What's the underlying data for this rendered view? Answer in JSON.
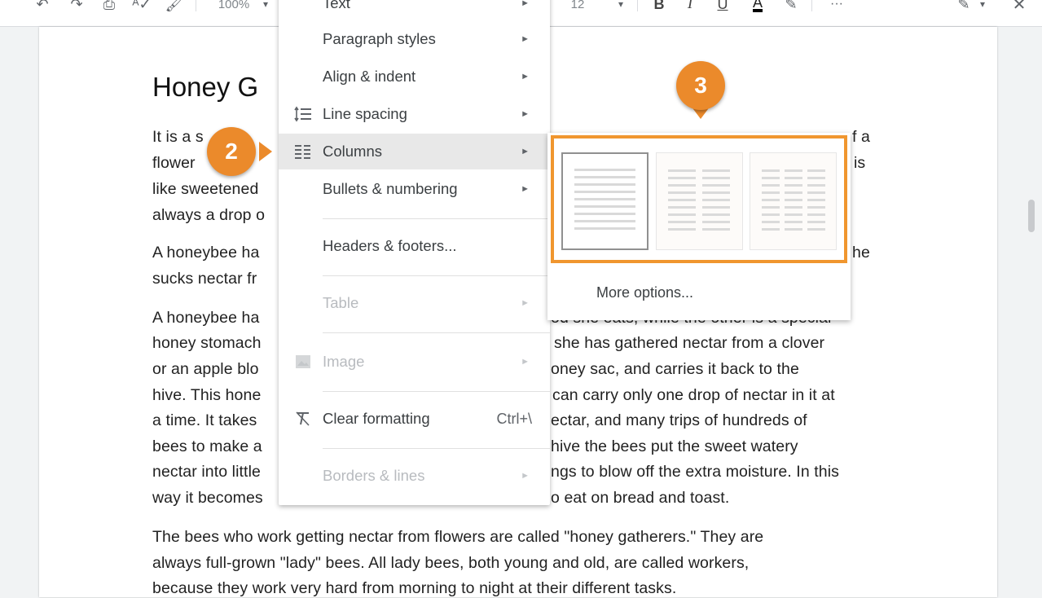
{
  "toolbar": {
    "zoom": "100%",
    "font_size": "12",
    "bold": "B",
    "italic": "I",
    "underline": "U",
    "text_color": "A",
    "more": "···"
  },
  "document": {
    "title": "Honey G",
    "lines": [
      "It is a s",
      "flower",
      "like sweetened",
      "always a drop o",
      "A honeybee ha",
      "sucks nectar fr",
      "A honeybee ha",
      "honey stomach",
      "or an apple blo",
      "hive. This hone",
      "a time. It takes",
      "bees to make a",
      "nectar into little",
      "way it becomes",
      "The bees who work getting nectar from flowers are called \"honey gatherers.\" They are",
      "always full-grown \"lady\" bees. All lady bees, both young and old, are called workers,",
      "because they work very hard from morning to night at their different tasks."
    ],
    "right_fragments": [
      "f a",
      "is",
      "he",
      "od she eats, while the other is a special",
      "she has gathered nectar from a clover",
      "oney sac, and carries it back to the",
      "can carry only one drop of nectar in it at",
      "ectar, and many trips of hundreds of",
      "hive the bees put the sweet watery",
      "ngs to blow off the extra moisture. In this",
      "o eat on bread and toast."
    ]
  },
  "format_menu": {
    "items": [
      {
        "label": "Text",
        "icon": "",
        "arrow": "►",
        "shortcut": "",
        "disabled": false
      },
      {
        "label": "Paragraph styles",
        "icon": "",
        "arrow": "►",
        "shortcut": "",
        "disabled": false
      },
      {
        "label": "Align & indent",
        "icon": "",
        "arrow": "►",
        "shortcut": "",
        "disabled": false
      },
      {
        "label": "Line spacing",
        "icon": "line-spacing-icon",
        "arrow": "►",
        "shortcut": "",
        "disabled": false
      },
      {
        "label": "Columns",
        "icon": "columns-icon",
        "arrow": "►",
        "shortcut": "",
        "disabled": false
      },
      {
        "label": "Bullets & numbering",
        "icon": "",
        "arrow": "►",
        "shortcut": "",
        "disabled": false
      },
      {
        "label": "Headers & footers...",
        "icon": "",
        "arrow": "",
        "shortcut": "",
        "disabled": false
      },
      {
        "label": "Table",
        "icon": "",
        "arrow": "►",
        "shortcut": "",
        "disabled": true
      },
      {
        "label": "Image",
        "icon": "image-icon",
        "arrow": "►",
        "shortcut": "",
        "disabled": true
      },
      {
        "label": "Clear formatting",
        "icon": "clear-formatting-icon",
        "arrow": "",
        "shortcut": "Ctrl+\\",
        "disabled": false
      },
      {
        "label": "Borders & lines",
        "icon": "",
        "arrow": "►",
        "shortcut": "",
        "disabled": true
      }
    ]
  },
  "columns_submenu": {
    "options": [
      "one-column",
      "two-columns",
      "three-columns"
    ],
    "selected": "one-column",
    "more_options": "More options..."
  },
  "callouts": {
    "step2": "2",
    "step3": "3",
    "color": "#eb8a2b"
  },
  "colors": {
    "highlight_border": "#f0962f",
    "active_row": "#e8e8e8",
    "disabled_text": "#b8bbbf"
  }
}
